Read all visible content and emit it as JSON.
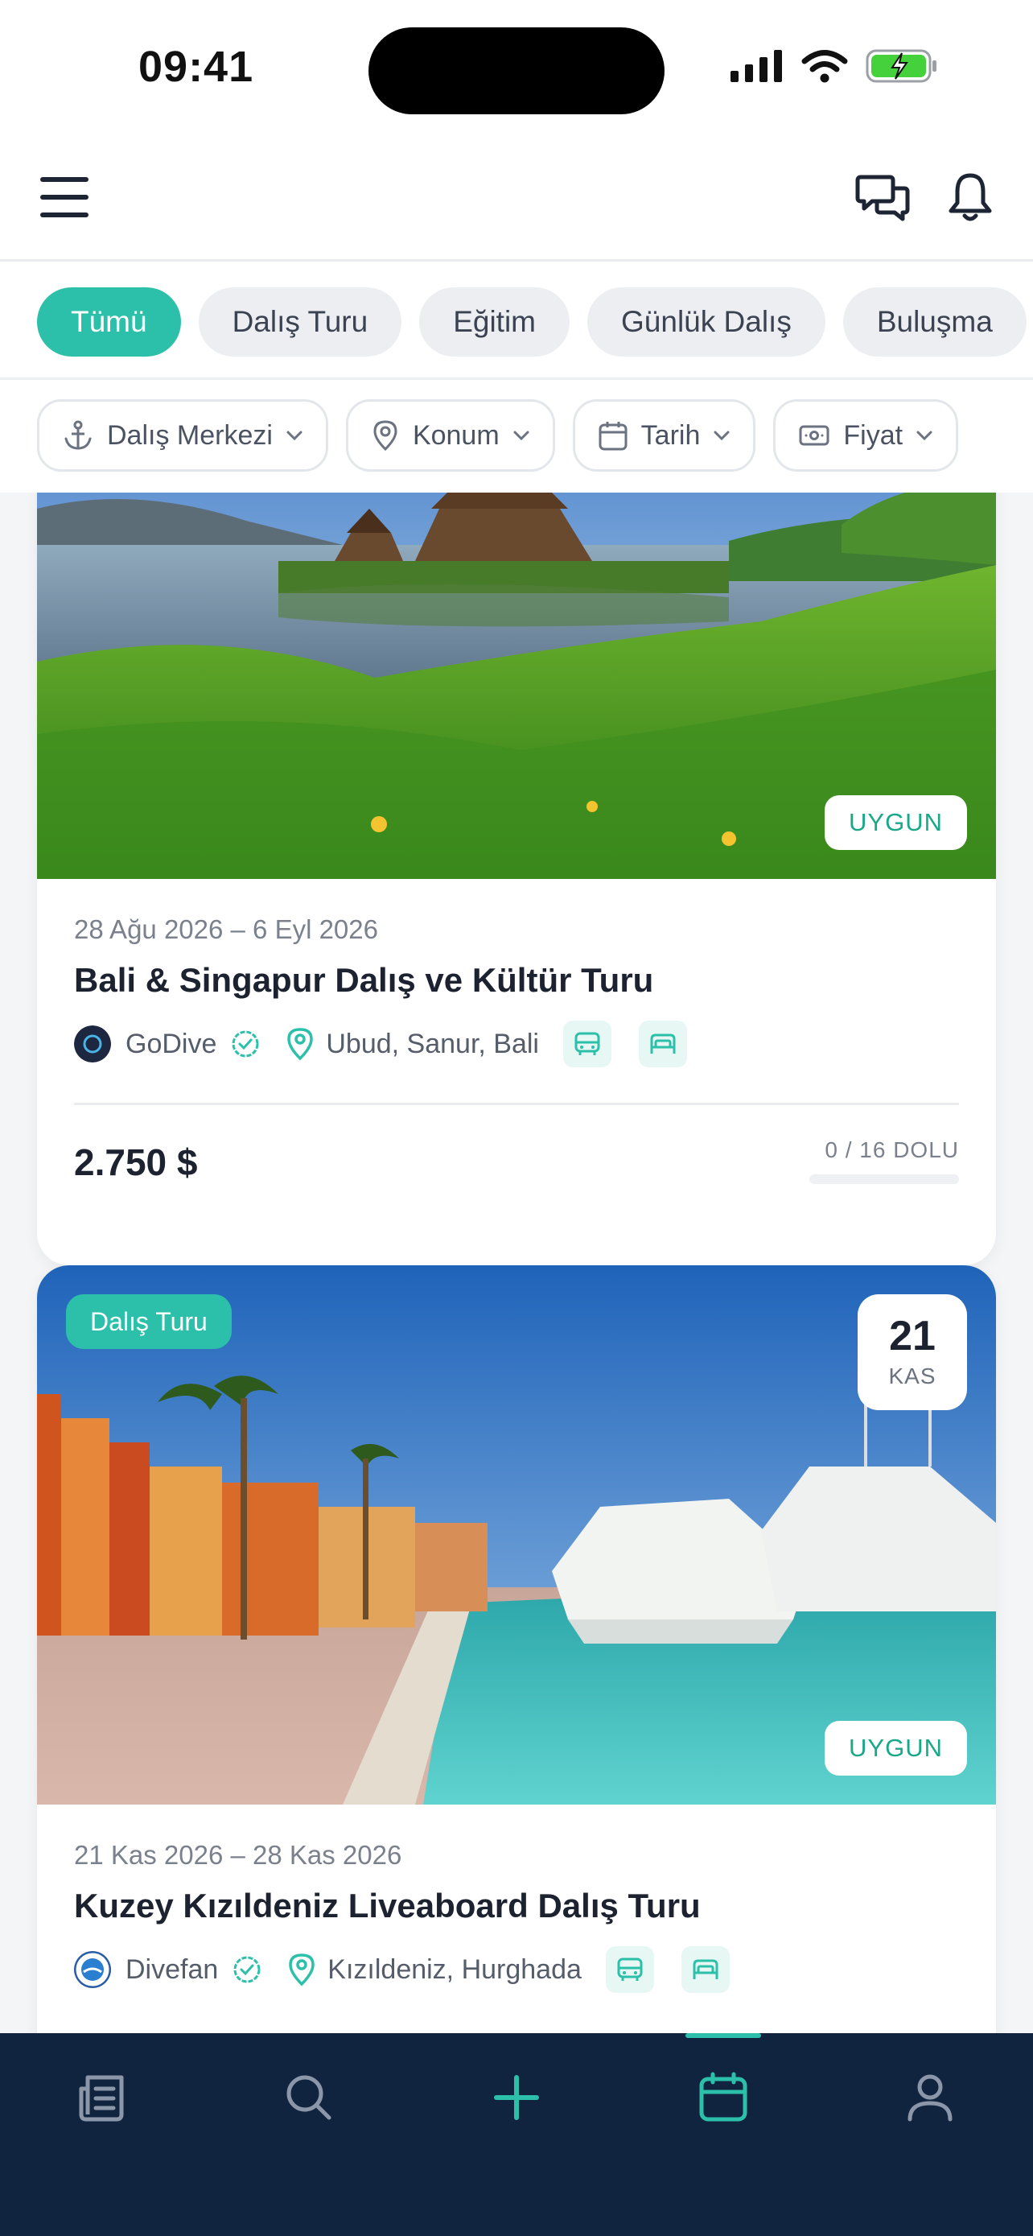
{
  "status_bar": {
    "time": "09:41"
  },
  "header": {
    "menu_icon": "hamburger-menu-icon",
    "messages_icon": "chat-bubbles-icon",
    "notifications_icon": "bell-icon"
  },
  "chips": [
    {
      "label": "Tümü",
      "active": true
    },
    {
      "label": "Dalış Turu",
      "active": false
    },
    {
      "label": "Eğitim",
      "active": false
    },
    {
      "label": "Günlük Dalış",
      "active": false
    },
    {
      "label": "Buluşma",
      "active": false
    }
  ],
  "filters": [
    {
      "label": "Dalış Merkezi",
      "icon": "anchor-icon"
    },
    {
      "label": "Konum",
      "icon": "location-pin-icon"
    },
    {
      "label": "Tarih",
      "icon": "calendar-icon"
    },
    {
      "label": "Fiyat",
      "icon": "money-icon"
    }
  ],
  "events": [
    {
      "status": "UYGUN",
      "date_range": "28 Ağu 2026 – 6 Eyl 2026",
      "title": "Bali & Singapur Dalış ve Kültür Turu",
      "organizer": "GoDive",
      "location": "Ubud, Sanur, Bali",
      "amenities": [
        "bus-icon",
        "bed-icon"
      ],
      "price": "2.750 $",
      "capacity_text": "0 / 16 DOLU",
      "capacity_fraction": 0
    },
    {
      "category": "Dalış Turu",
      "day": "21",
      "month": "KAS",
      "status": "UYGUN",
      "date_range": "21 Kas 2026 – 28 Kas 2026",
      "title": "Kuzey Kızıldeniz Liveaboard Dalış Turu",
      "organizer": "Divefan",
      "location": "Kızıldeniz, Hurghada",
      "amenities": [
        "bus-icon",
        "bed-icon"
      ]
    }
  ],
  "colors": {
    "accent": "#2cc0aa",
    "nav_bg": "#11243f",
    "available": "#19a989"
  },
  "bottom_nav": [
    {
      "icon": "news-icon",
      "active": false
    },
    {
      "icon": "search-icon",
      "active": false
    },
    {
      "icon": "plus-icon",
      "active": false
    },
    {
      "icon": "calendar-icon",
      "active": true
    },
    {
      "icon": "profile-icon",
      "active": false
    }
  ]
}
